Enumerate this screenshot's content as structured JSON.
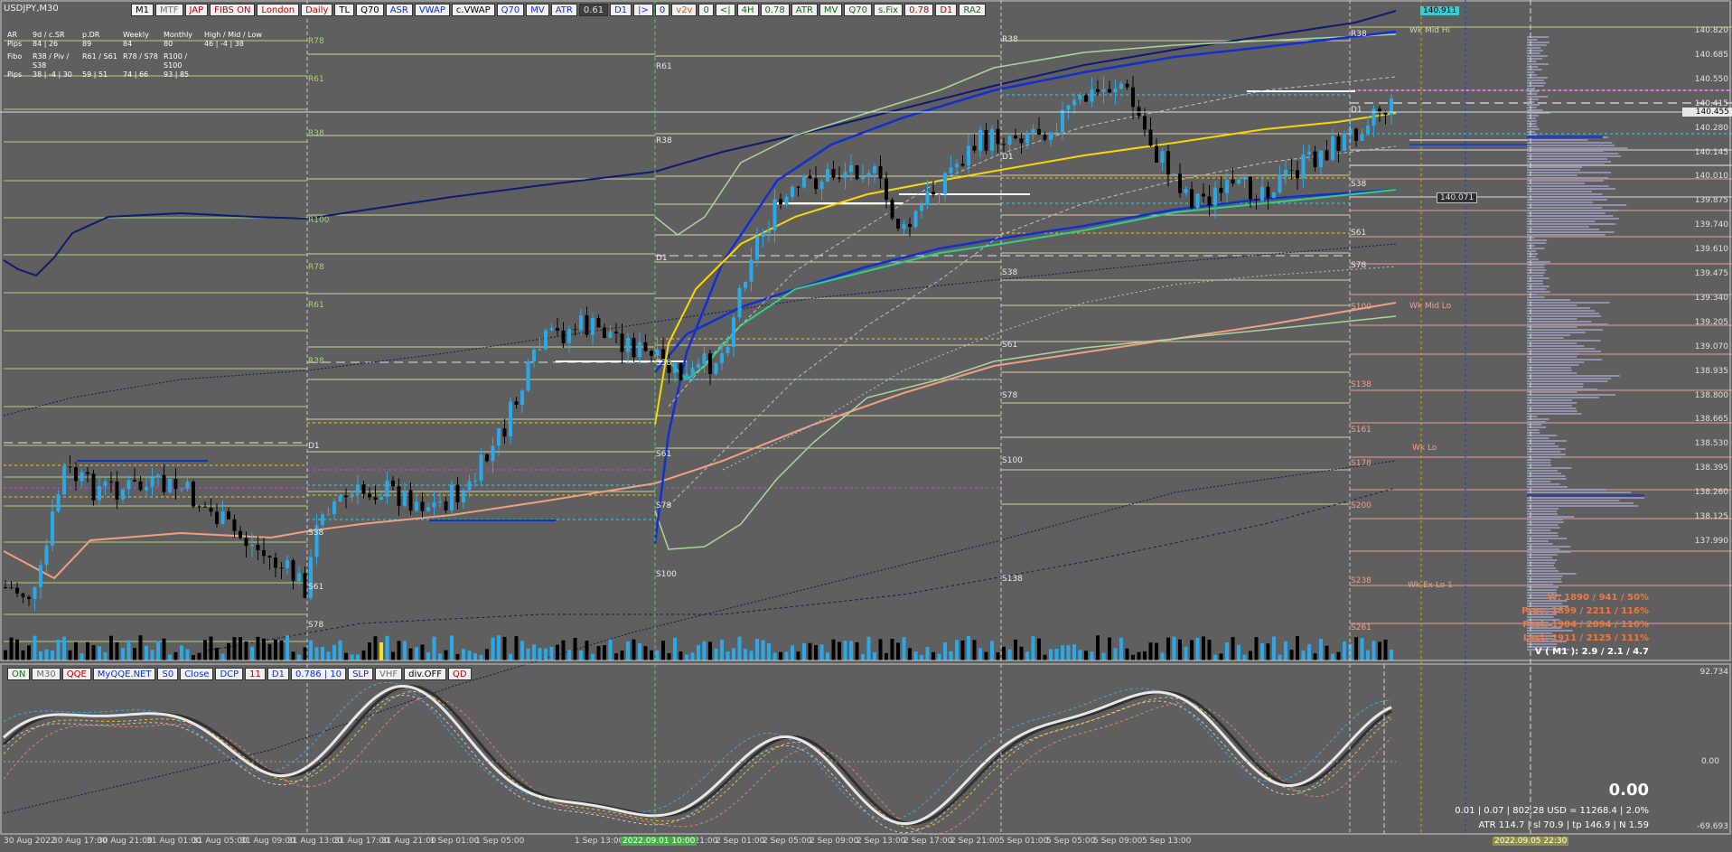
{
  "window": {
    "symbol_title": "USDJPY,M30"
  },
  "top_toolbar": [
    {
      "label": "M1",
      "style": "plain"
    },
    {
      "label": "MTF",
      "style": "gray"
    },
    {
      "label": "JAP",
      "style": "red"
    },
    {
      "label": "FIBS ON",
      "style": "red"
    },
    {
      "label": "London",
      "style": "red"
    },
    {
      "label": "Daily",
      "style": "red"
    },
    {
      "label": "TL",
      "style": "plain"
    },
    {
      "label": "Q70",
      "style": "plain"
    },
    {
      "label": "ASR",
      "style": "blue"
    },
    {
      "label": "VWAP",
      "style": "blue"
    },
    {
      "label": "c.VWAP",
      "style": "plain"
    },
    {
      "label": "Q70",
      "style": "blue"
    },
    {
      "label": "MV",
      "style": "blue"
    },
    {
      "label": "ATR",
      "style": "blue"
    },
    {
      "label": "0.61",
      "style": "dark"
    },
    {
      "label": "D1",
      "style": "blue"
    },
    {
      "label": "|>",
      "style": "blue"
    },
    {
      "label": "0",
      "style": "blue"
    },
    {
      "label": "v2v",
      "style": "orange"
    },
    {
      "label": "0",
      "style": "green"
    },
    {
      "label": "<|",
      "style": "green"
    },
    {
      "label": "4H",
      "style": "green"
    },
    {
      "label": "0.78",
      "style": "green"
    },
    {
      "label": "ATR",
      "style": "green"
    },
    {
      "label": "MV",
      "style": "green"
    },
    {
      "label": "Q70",
      "style": "green"
    },
    {
      "label": "s.Fix",
      "style": "green"
    },
    {
      "label": "0.78",
      "style": "red"
    },
    {
      "label": "D1",
      "style": "red"
    },
    {
      "label": "RA2",
      "style": "green"
    }
  ],
  "sub_toolbar": [
    {
      "label": "ON",
      "style": "green"
    },
    {
      "label": "M30",
      "style": "gray"
    },
    {
      "label": "QQE",
      "style": "red"
    },
    {
      "label": "MyQQE.NET",
      "style": "blue"
    },
    {
      "label": "S0",
      "style": "blue"
    },
    {
      "label": "Close",
      "style": "blue"
    },
    {
      "label": "DCP",
      "style": "blue"
    },
    {
      "label": "11",
      "style": "red"
    },
    {
      "label": "D1",
      "style": "blue"
    },
    {
      "label": "0.786 | 10",
      "style": "blue"
    },
    {
      "label": "SLP",
      "style": "blue"
    },
    {
      "label": "VHF",
      "style": "gray"
    },
    {
      "label": "div.OFF",
      "style": "plain"
    },
    {
      "label": "QD",
      "style": "red"
    }
  ],
  "info_panel": {
    "rows": [
      [
        "AR",
        "9d / c.SR",
        "p.DR",
        "Weekly",
        "Monthly",
        "High / Mid / Low"
      ],
      [
        "Pips",
        "84 | 26",
        "89",
        "84",
        "80",
        "46 | -4 | 38"
      ],
      [
        "Fibo",
        "R38 / Piv / S38",
        "R61 / S61",
        "R78 / S78",
        "R100 / S100",
        ""
      ],
      [
        "Pips",
        "38 | -4 | 30",
        "59 | 51",
        "74 | 66",
        "93 | 85",
        ""
      ]
    ]
  },
  "price_axis": {
    "labels": [
      "140.820",
      "140.685",
      "140.550",
      "140.415",
      "140.280",
      "140.145",
      "140.010",
      "139.875",
      "139.740",
      "139.610",
      "139.475",
      "139.340",
      "139.205",
      "139.070",
      "138.935",
      "138.800",
      "138.665",
      "138.530",
      "138.395",
      "138.260",
      "138.125",
      "137.990"
    ],
    "current_price": "140.455",
    "high_tag": "140.911",
    "marker_tag": "140.071"
  },
  "osc_axis": {
    "top": "92.734",
    "mid": "0.00",
    "bottom": "-69.693"
  },
  "time_axis": [
    "30 Aug 2022",
    "30 Aug 17:00",
    "30 Aug 21:00",
    "31 Aug 01:00",
    "31 Aug 05:00",
    "31 Aug 09:00",
    "31 Aug 13:00",
    "31 Aug 17:00",
    "31 Aug 21:00",
    "1 Sep 01:00",
    "1 Sep 05:00",
    "1 Sep 13:00",
    "1 Sep 17:00",
    "1 Sep 21:00",
    "2 Sep 01:00",
    "2 Sep 05:00",
    "2 Sep 09:00",
    "2 Sep 13:00",
    "2 Sep 17:00",
    "2 Sep 21:00",
    "5 Sep 01:00",
    "5 Sep 05:00",
    "5 Sep 09:00",
    "5 Sep 13:00"
  ],
  "time_highlight_1": "2022.09.01 10:00",
  "time_highlight_2": "2022.09.05 22:30",
  "level_labels": {
    "day1": [
      "R78",
      "R61",
      "R38",
      "R100",
      "R78",
      "R61",
      "R38",
      "D1",
      "S38",
      "S61",
      "S78"
    ],
    "day2": [
      "R61",
      "R38",
      "D1",
      "S38",
      "S61",
      "S78",
      "S100"
    ],
    "day3": [
      "R38",
      "D1",
      "S38",
      "S61",
      "S78",
      "S100",
      "S138"
    ],
    "day4": [
      "R38",
      "D1",
      "S38",
      "S61",
      "S78",
      "S100",
      "S138",
      "S161",
      "S178",
      "S200",
      "S238",
      "S261"
    ],
    "weekly": [
      "Wk Mid Hi",
      "Wk Mid Lo",
      "Wk Lo",
      "Wk Ex Lo 1"
    ]
  },
  "stats": {
    "w": "W: 1890 / 941 / 50%",
    "prev": "Prev: 1899 / 2211 / 116%",
    "past": "Past: 1904 / 2094 / 110%",
    "last": "Last: 1911 / 2125 / 111%",
    "vm1": "V ( M1 ): 2.9 / 2.1 / 4.7"
  },
  "account": {
    "pl": "0.00",
    "line1": "0.01  |  0.07  |  802.28 USD = 11268.4  |  2.0%",
    "line2": "ATR 114.7  |  sl 70.9  |  tp 146.9  |  N 1.59"
  },
  "colors": {
    "background": "#5f5f5f",
    "bull": "#2aa8e8",
    "bear": "#000000",
    "vwap_yellow": "#f8d800",
    "salmon": "#f0a080",
    "navy": "#101a70",
    "blue": "#1030d0",
    "green": "#30d080"
  }
}
